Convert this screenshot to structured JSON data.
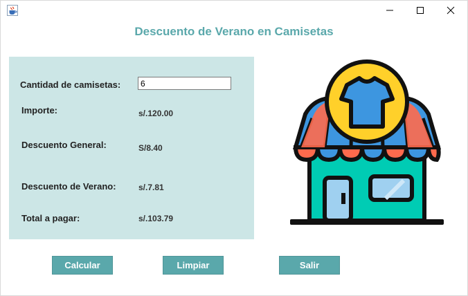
{
  "window": {
    "controls": {
      "minimize": "—",
      "maximize": "☐",
      "close": "✕"
    }
  },
  "heading": "Descuento de Verano en Camisetas",
  "form": {
    "cantidad_label": "Cantidad de camisetas:",
    "cantidad_value": "6",
    "importe_label": "Importe:",
    "importe_value": "s/.120.00",
    "descuento_general_label": "Descuento General:",
    "descuento_general_value": "S/8.40",
    "descuento_verano_label": "Descuento de Verano:",
    "descuento_verano_value": "s/.7.81",
    "total_label": "Total a pagar:",
    "total_value": "s/.103.79"
  },
  "buttons": {
    "calcular": "Calcular",
    "limpiar": "Limpiar",
    "salir": "Salir"
  },
  "colors": {
    "accent": "#5aa8ab",
    "panel": "#cce6e6",
    "shop_wall": "#00ccb4",
    "awning_red": "#ff6a4d",
    "awning_blue": "#3d96e0",
    "badge_yellow": "#ffd02a"
  },
  "icons": {
    "app": "java-cup-icon",
    "illustration": "t-shirt-store-icon"
  }
}
